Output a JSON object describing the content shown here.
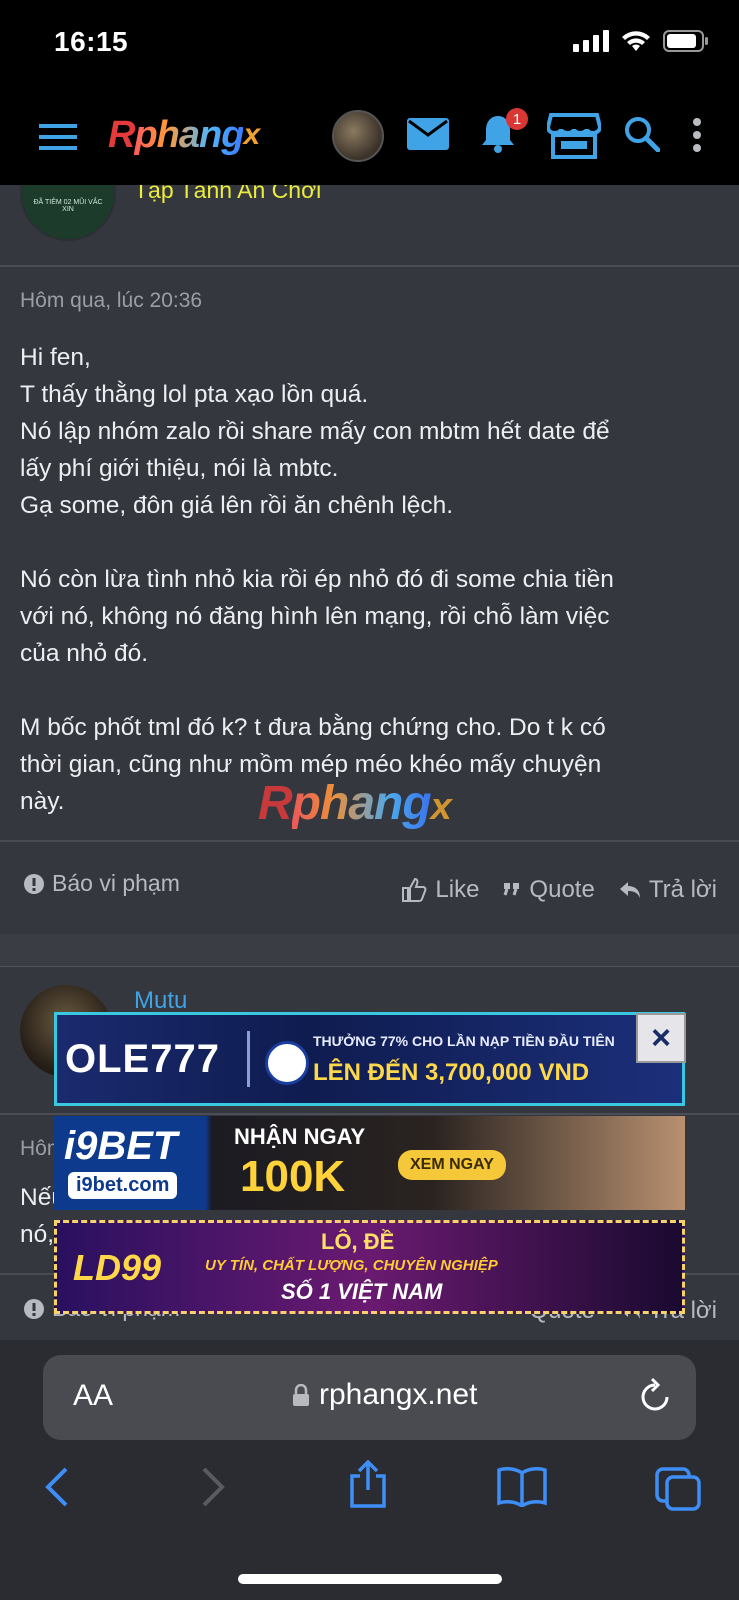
{
  "status": {
    "time": "16:15"
  },
  "nav": {
    "logo_r": "R",
    "logo_main": "phang",
    "logo_x": "x",
    "notification_count": "1"
  },
  "posts": [
    {
      "user_title": "Tập Tành An Chơi",
      "avatar_text": "ĐÃ TIÊM 02 MŨI VẮC XIN",
      "date": "Hôm qua, lúc 20:36",
      "lines": [
        "Hi fen,",
        "T thấy thằng lol pta xạo lồn quá.",
        "Nó lập nhóm zalo rồi share mấy con mbtm hết date để",
        "lấy phí giới thiệu, nói là mbtc.",
        "Gạ some, đôn giá lên rồi ăn chênh lệch.",
        "",
        "Nó còn lừa tình nhỏ kia rồi ép nhỏ đó đi some chia tiền",
        "với nó, không nó đăng hình lên mạng, rồi chỗ làm việc",
        "của nhỏ đó.",
        "",
        "M bốc phốt tml đó k? t đưa bằng chứng cho. Do t k có",
        "thời gian, cũng như mồm mép méo khéo mấy chuyện",
        "này."
      ],
      "report": "Báo vi phạm",
      "like": "Like",
      "quote": "Quote",
      "reply": "Trả lời"
    },
    {
      "username": "Mutu",
      "date_partial": "Hôm",
      "lines": [
        "Nếu bạo có thì đưa tôi,nếu lời k ử e tới sàn sàng phốt",
        "nó,"
      ],
      "report": "Báo vi phạm",
      "quote": "Quote",
      "reply": "Trả lời"
    }
  ],
  "ads": {
    "ad1": {
      "brand": "OLE777",
      "line1": "THƯỞNG 77% CHO LẦN NẠP TIỀN ĐẦU TIÊN",
      "line2": "LÊN ĐẾN 3,700,000 VND"
    },
    "ad2": {
      "brand": "i9BET",
      "site": "i9bet.com",
      "line1": "NHẬN NGAY",
      "amount": "100K",
      "cta": "XEM NGAY"
    },
    "ad3": {
      "brand": "LD99",
      "line1": "LÔ, ĐỀ",
      "line2": "UY TÍN, CHẤT LƯỢNG, CHUYÊN NGHIỆP",
      "line3": "SỐ 1 VIỆT NAM"
    },
    "close": "×"
  },
  "watermark": {
    "r": "R",
    "main": "phang",
    "x": "x"
  },
  "safari": {
    "aa": "AA",
    "url": "rphangx.net"
  }
}
